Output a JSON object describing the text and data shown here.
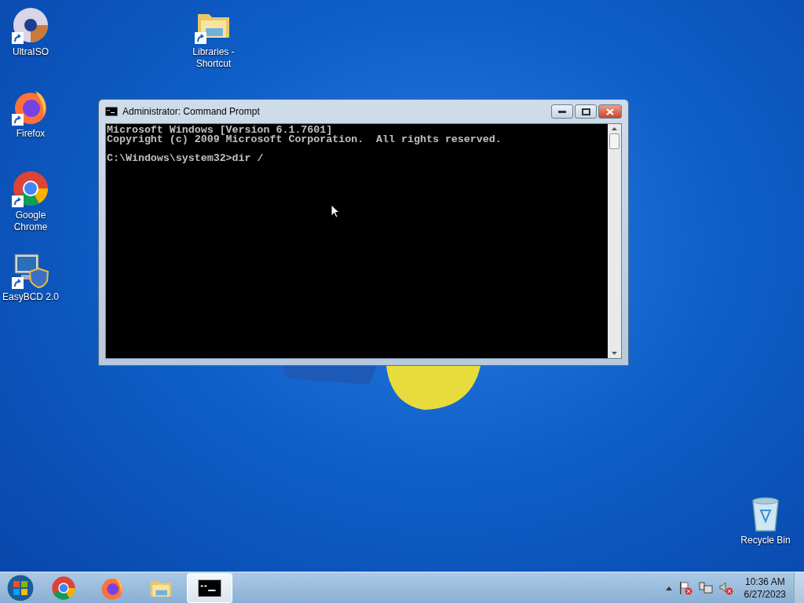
{
  "desktop_icons": [
    {
      "kind": "disc",
      "label": "UltraISO"
    },
    {
      "kind": "firefox",
      "label": "Firefox"
    },
    {
      "kind": "chrome",
      "label": "Google Chrome"
    },
    {
      "kind": "easybcd",
      "label": "EasyBCD 2.0"
    },
    {
      "kind": "folder",
      "label": "Libraries - Shortcut"
    },
    {
      "kind": "recycle",
      "label": "Recycle Bin"
    }
  ],
  "window": {
    "title": "Administrator:  Command Prompt",
    "console": {
      "header": [
        "Microsoft Windows [Version 6.1.7601]",
        "Copyright (c) 2009 Microsoft Corporation.  All rights reserved."
      ],
      "prompt": "C:\\Windows\\system32>dir /"
    }
  },
  "taskbar": {
    "buttons": [
      {
        "kind": "chrome",
        "selected": false
      },
      {
        "kind": "firefox",
        "selected": false
      },
      {
        "kind": "folder",
        "selected": false
      },
      {
        "kind": "cmd",
        "selected": true
      }
    ],
    "clock": {
      "time": "10:36 AM",
      "date": "6/27/2023"
    }
  }
}
